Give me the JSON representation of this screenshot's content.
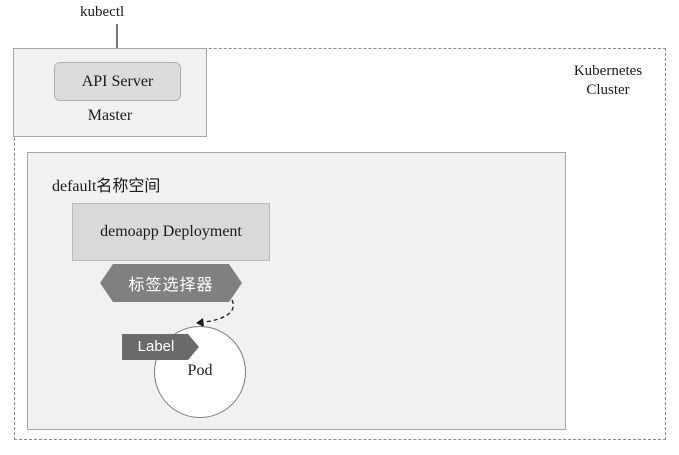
{
  "kubectl": {
    "label": "kubectl"
  },
  "cluster": {
    "title_line1": "Kubernetes",
    "title_line2": "Cluster"
  },
  "master": {
    "api_server_label": "API Server",
    "label": "Master"
  },
  "namespace": {
    "label": "default名称空间"
  },
  "deployment": {
    "label": "demoapp Deployment"
  },
  "selector": {
    "label": "标签选择器"
  },
  "pod": {
    "label": "Pod",
    "tag_label": "Label"
  },
  "colors": {
    "container_fill": "#f1f1f1",
    "box_border": "#a7a7a7",
    "deployment_fill": "#d9d9d9",
    "selector_fill": "#808080",
    "label_tag_fill": "#6a6a6a",
    "dashed_border": "#8a8a8a"
  }
}
